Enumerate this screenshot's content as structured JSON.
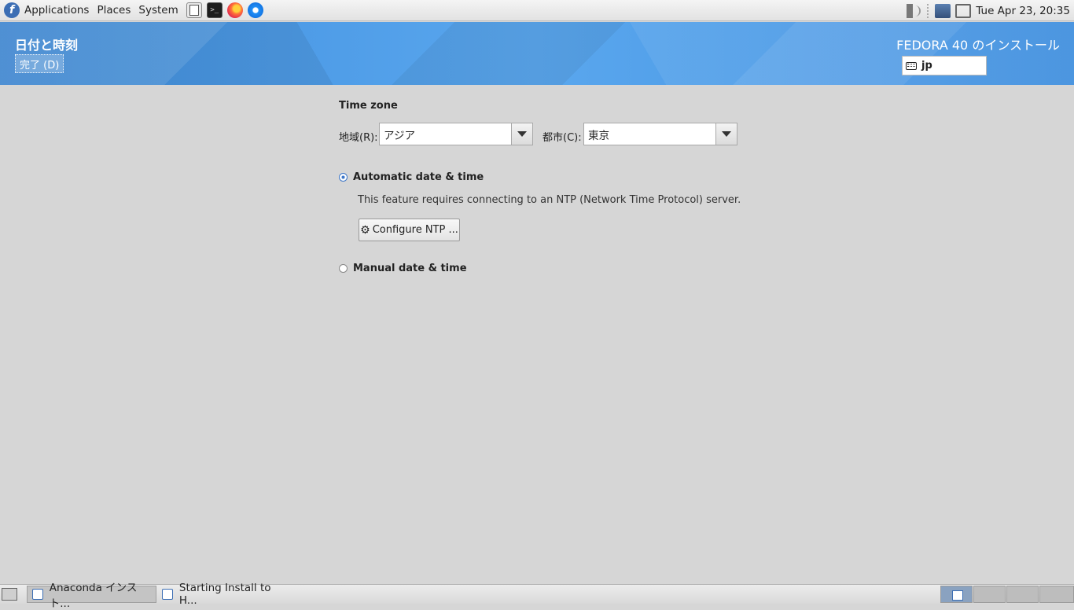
{
  "top_panel": {
    "menus": [
      "Applications",
      "Places",
      "System"
    ],
    "clock": "Tue Apr 23, 20:35",
    "launchers": [
      "files-icon",
      "terminal-icon",
      "firefox-icon",
      "thunderbird-icon"
    ]
  },
  "header": {
    "spoke_title": "日付と時刻",
    "done_label": "完了 (D)",
    "install_title": "FEDORA 40 のインストール",
    "keyboard_layout": "jp"
  },
  "timezone": {
    "section_label": "Time zone",
    "region_label": "地域(R):",
    "region_value": "アジア",
    "city_label": "都市(C):",
    "city_value": "東京"
  },
  "datetime": {
    "auto_label": "Automatic date & time",
    "auto_selected": true,
    "auto_hint": "This feature requires connecting to an NTP (Network Time Protocol) server.",
    "ntp_button_label": "Configure NTP ...",
    "manual_label": "Manual date & time",
    "manual_selected": false
  },
  "taskbar": {
    "tasks": [
      {
        "label": "Anaconda インスト...",
        "active": true
      },
      {
        "label": "Starting Install to H...",
        "active": false
      }
    ],
    "workspaces": 4,
    "current_workspace": 1
  },
  "colors": {
    "banner_blue": "#4a9be6",
    "radio_accent": "#3c76c8",
    "background": "#d6d6d6"
  }
}
